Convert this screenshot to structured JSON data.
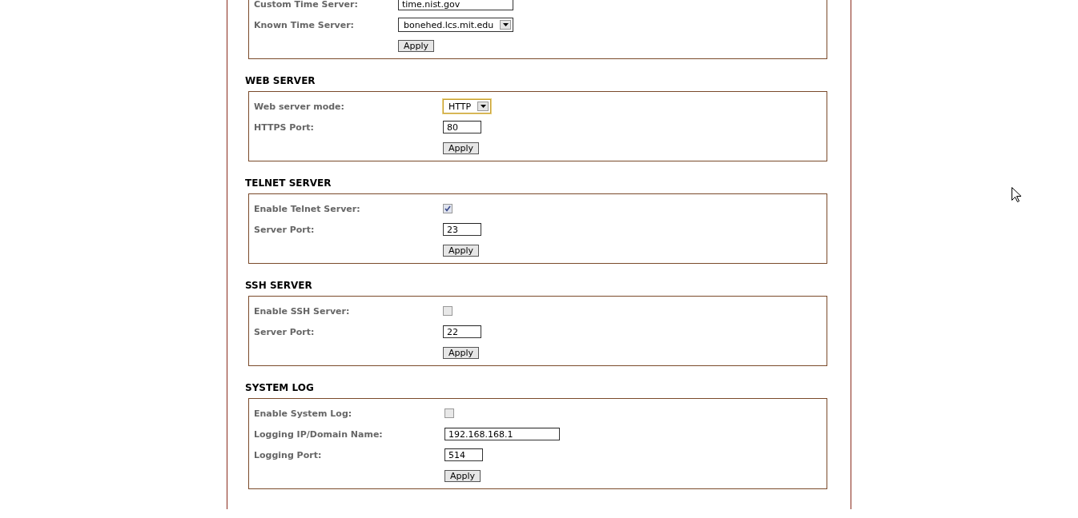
{
  "sections": [
    {
      "rows": [
        {
          "kind": "text",
          "label": "Custom Time Server:",
          "value": "time.nist.gov"
        },
        {
          "kind": "select",
          "label": "Known Time Server:",
          "value": "bonehed.lcs.mit.edu",
          "focused": false
        },
        {
          "kind": "button",
          "text": "Apply"
        }
      ]
    },
    {
      "heading": "WEB SERVER",
      "rows": [
        {
          "kind": "select",
          "label": "Web server mode:",
          "value": "HTTP",
          "focused": true
        },
        {
          "kind": "port",
          "label": "HTTPS Port:",
          "value": "80"
        },
        {
          "kind": "button",
          "text": "Apply"
        }
      ]
    },
    {
      "heading": "TELNET SERVER",
      "rows": [
        {
          "kind": "checkbox",
          "label": "Enable Telnet Server:",
          "checked": true
        },
        {
          "kind": "port",
          "label": "Server Port:",
          "value": "23"
        },
        {
          "kind": "button",
          "text": "Apply"
        }
      ]
    },
    {
      "heading": "SSH SERVER",
      "rows": [
        {
          "kind": "checkbox",
          "label": "Enable SSH Server:",
          "checked": false
        },
        {
          "kind": "port",
          "label": "Server Port:",
          "value": "22"
        },
        {
          "kind": "button",
          "text": "Apply"
        }
      ]
    },
    {
      "heading": "SYSTEM LOG",
      "rows": [
        {
          "kind": "checkbox",
          "label": "Enable System Log:",
          "checked": false
        },
        {
          "kind": "text",
          "label": "Logging IP/Domain Name:",
          "value": "192.168.168.1"
        },
        {
          "kind": "port",
          "label": "Logging Port:",
          "value": "514"
        },
        {
          "kind": "button",
          "text": "Apply"
        }
      ]
    }
  ]
}
